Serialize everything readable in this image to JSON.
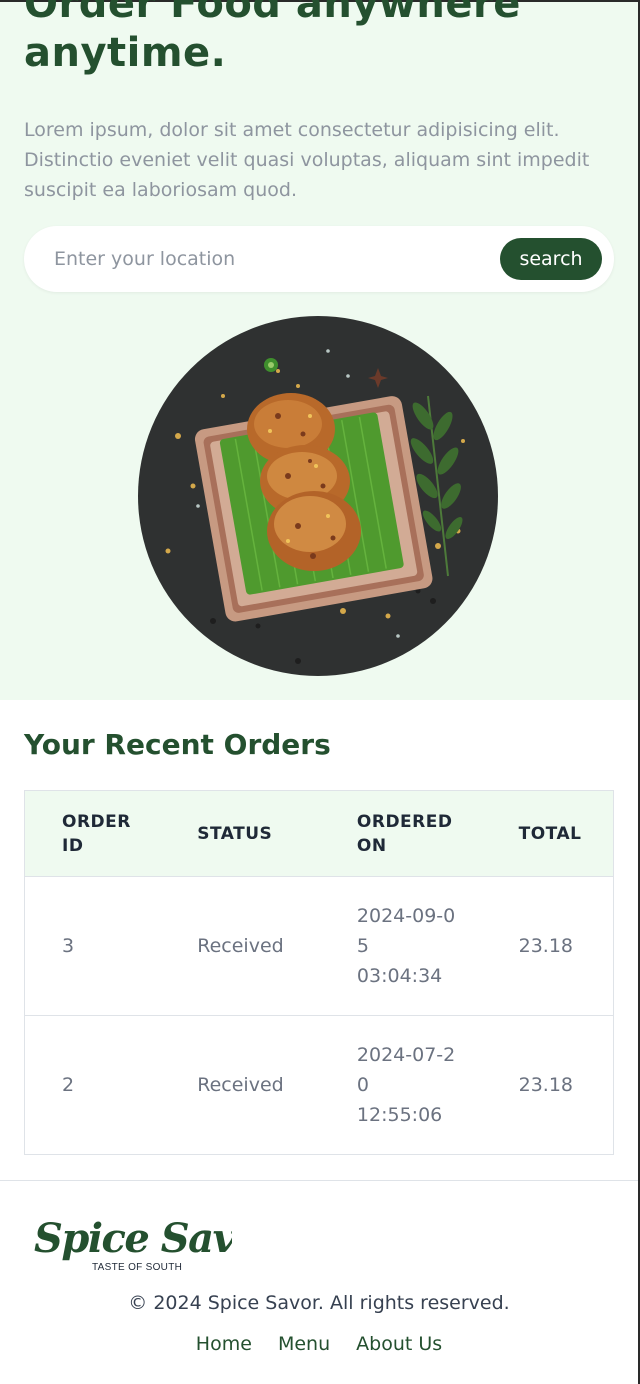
{
  "hero": {
    "title": "Order Food anywhere anytime.",
    "description": "Lorem ipsum, dolor sit amet consectetur adipisicing elit. Distinctio eveniet velit quasi voluptas, aliquam sint impedit suscipit ea laboriosam quod.",
    "search": {
      "placeholder": "Enter your location",
      "value": "",
      "button_label": "search"
    },
    "image_icon": "food-plate-image"
  },
  "orders": {
    "title": "Your Recent Orders",
    "columns": [
      "ORDER ID",
      "STATUS",
      "ORDERED ON",
      "TOTAL"
    ],
    "rows": [
      {
        "order_id": "3",
        "status": "Received",
        "date": "2024-09-05",
        "time": "03:04:34",
        "total": "23.18"
      },
      {
        "order_id": "2",
        "status": "Received",
        "date": "2024-07-20",
        "time": "12:55:06",
        "total": "23.18"
      }
    ]
  },
  "footer": {
    "logo_text": "Spice Savor",
    "logo_tagline": "TASTE OF SOUTH",
    "copyright": "© 2024 Spice Savor. All rights reserved.",
    "nav": [
      "Home",
      "Menu",
      "About Us"
    ]
  },
  "colors": {
    "brand": "#24502f",
    "hero_bg": "#effaf0",
    "muted_text": "#8e959f"
  }
}
